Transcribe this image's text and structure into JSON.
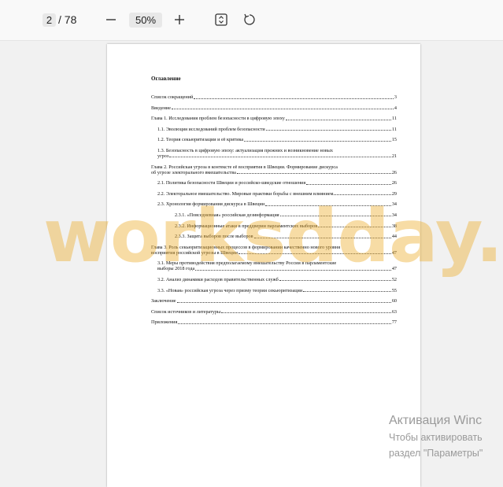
{
  "toolbar": {
    "current_page": "2",
    "total_pages": "/ 78",
    "zoom_level": "50%",
    "icons": [
      "minus-icon",
      "plus-icon",
      "fit-page-icon",
      "rotate-icon"
    ]
  },
  "document": {
    "toc_title": "Оглавление",
    "entries": [
      {
        "level": 1,
        "text": "Список сокращений",
        "page": "3"
      },
      {
        "level": 1,
        "text": "Введение",
        "page": "4"
      },
      {
        "level": 1,
        "text": "Глава 1. Исследования проблем безопасности в цифровую эпоху",
        "page": "11"
      },
      {
        "level": 2,
        "text": "1.1. Эволюция исследований проблем безопасности",
        "page": "11"
      },
      {
        "level": 2,
        "text": "1.2. Теория секьюритизации и её критика",
        "page": "15"
      },
      {
        "level": 2,
        "multiline": true,
        "text_line1": "1.3. Безопасность в цифровую эпоху: актуализация прежних и возникновение новых",
        "text_line2": "угроз",
        "page": "21"
      },
      {
        "level": 1,
        "multiline": true,
        "text_line1": "Глава 2. Российская угроза в контексте её восприятия в Швеции. Формирование дискурса",
        "text_line2": "об угрозе электорального вмешательства",
        "page": "26"
      },
      {
        "level": 2,
        "text": "2.1. Политика безопасности Швеции и российско-шведские отношения",
        "page": "26"
      },
      {
        "level": 2,
        "text": "2.2. Электоральное вмешательство. Мировые практики борьбы с внешним влиянием",
        "page": "29"
      },
      {
        "level": 2,
        "text": "2.3. Хронология формирования дискурса в Швеции",
        "page": "34"
      },
      {
        "level": 3,
        "text": "2.3.1. «Повседневная» российская дезинформация",
        "page": "34"
      },
      {
        "level": 3,
        "text": "2.3.2. Информационные атаки в преддверии парламентских выборов",
        "page": "38"
      },
      {
        "level": 3,
        "text": "2.3.3. Защита выборов после выборов",
        "page": "44"
      },
      {
        "level": 1,
        "multiline": true,
        "text_line1": "Глава 3. Роль секьюритизационных процессов в формировании качественно нового уровня",
        "text_line2": "восприятия российской угрозы в Швеции",
        "page": "47"
      },
      {
        "level": 2,
        "multiline": true,
        "text_line1": "3.1. Меры противодействия предполагаемому вмешательству России в парламентские",
        "text_line2": "выборы 2018 года",
        "page": "47"
      },
      {
        "level": 2,
        "text": "3.2. Анализ динамики расходов правительственных служб",
        "page": "52"
      },
      {
        "level": 2,
        "text": "3.3. «Новая» российская угроза через призму теории секьюритизации",
        "page": "55"
      },
      {
        "level": 1,
        "text": "Заключение",
        "page": "60"
      },
      {
        "level": 1,
        "text": "Список источников и литературы",
        "page": "63"
      },
      {
        "level": 1,
        "text": "Приложения",
        "page": "77"
      }
    ]
  },
  "watermark": "worksdday.ru",
  "windows_activation": {
    "title": "Активация Winc",
    "line1": "Чтобы активировать",
    "line2": "раздел \"Параметры\""
  }
}
